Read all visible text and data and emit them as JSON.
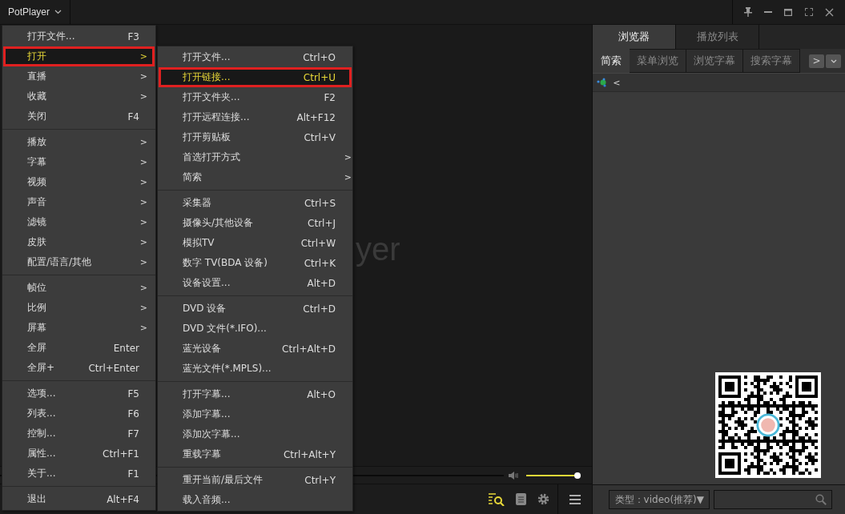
{
  "title_bar": {
    "app_name": "PotPlayer"
  },
  "video": {
    "logo_text": "yer"
  },
  "main_menu": [
    [
      {
        "label": "打开文件...",
        "shortcut": "F3",
        "selected": false
      },
      {
        "label": "打开",
        "arrow": ">",
        "selected": true
      },
      {
        "label": "直播",
        "arrow": ">",
        "selected": false
      },
      {
        "label": "收藏",
        "arrow": ">",
        "selected": false
      },
      {
        "label": "关闭",
        "shortcut": "F4",
        "selected": false
      }
    ],
    [
      {
        "label": "播放",
        "arrow": ">",
        "selected": false
      },
      {
        "label": "字幕",
        "arrow": ">",
        "selected": false
      },
      {
        "label": "视频",
        "arrow": ">",
        "selected": false
      },
      {
        "label": "声音",
        "arrow": ">",
        "selected": false
      },
      {
        "label": "滤镜",
        "arrow": ">",
        "selected": false
      },
      {
        "label": "皮肤",
        "arrow": ">",
        "selected": false
      },
      {
        "label": "配置/语言/其他",
        "arrow": ">",
        "selected": false
      }
    ],
    [
      {
        "label": "帧位",
        "arrow": ">",
        "selected": false
      },
      {
        "label": "比例",
        "arrow": ">",
        "selected": false
      },
      {
        "label": "屏幕",
        "arrow": ">",
        "selected": false
      },
      {
        "label": "全屏",
        "shortcut": "Enter",
        "selected": false
      },
      {
        "label": "全屏+",
        "shortcut": "Ctrl+Enter",
        "selected": false
      }
    ],
    [
      {
        "label": "选项...",
        "shortcut": "F5",
        "selected": false
      },
      {
        "label": "列表...",
        "shortcut": "F6",
        "selected": false
      },
      {
        "label": "控制...",
        "shortcut": "F7",
        "selected": false
      },
      {
        "label": "属性...",
        "shortcut": "Ctrl+F1",
        "selected": false
      },
      {
        "label": "关于...",
        "shortcut": "F1",
        "selected": false
      }
    ],
    [
      {
        "label": "退出",
        "shortcut": "Alt+F4",
        "selected": false
      }
    ]
  ],
  "sub_menu": [
    [
      {
        "label": "打开文件...",
        "shortcut": "Ctrl+O",
        "selected": false
      },
      {
        "label": "打开链接...",
        "shortcut": "Ctrl+U",
        "selected": true
      },
      {
        "label": "打开文件夹...",
        "shortcut": "F2",
        "selected": false
      },
      {
        "label": "打开远程连接...",
        "shortcut": "Alt+F12",
        "selected": false
      },
      {
        "label": "打开剪贴板",
        "shortcut": "Ctrl+V",
        "selected": false
      },
      {
        "label": "首选打开方式",
        "arrow": ">",
        "selected": false
      },
      {
        "label": "简索",
        "arrow": ">",
        "selected": false
      }
    ],
    [
      {
        "label": "采集器",
        "shortcut": "Ctrl+S",
        "selected": false
      },
      {
        "label": "摄像头/其他设备",
        "shortcut": "Ctrl+J",
        "selected": false
      },
      {
        "label": "模拟TV",
        "shortcut": "Ctrl+W",
        "selected": false
      },
      {
        "label": "数字 TV(BDA 设备)",
        "shortcut": "Ctrl+K",
        "selected": false
      },
      {
        "label": "设备设置...",
        "shortcut": "Alt+D",
        "selected": false
      }
    ],
    [
      {
        "label": "DVD 设备",
        "shortcut": "Ctrl+D",
        "selected": false
      },
      {
        "label": "DVD 文件(*.IFO)...",
        "selected": false
      },
      {
        "label": "蓝光设备",
        "shortcut": "Ctrl+Alt+D",
        "selected": false
      },
      {
        "label": "蓝光文件(*.MPLS)...",
        "selected": false
      }
    ],
    [
      {
        "label": "打开字幕...",
        "shortcut": "Alt+O",
        "selected": false
      },
      {
        "label": "添加字幕...",
        "selected": false
      },
      {
        "label": "添加次字幕...",
        "selected": false
      },
      {
        "label": "重载字幕",
        "shortcut": "Ctrl+Alt+Y",
        "selected": false
      }
    ],
    [
      {
        "label": "重开当前/最后文件",
        "shortcut": "Ctrl+Y",
        "selected": false
      },
      {
        "label": "载入音频...",
        "selected": false
      }
    ]
  ],
  "volume": {
    "level": 1
  },
  "panel": {
    "tabs": [
      {
        "label": "浏览器",
        "selected": true
      },
      {
        "label": "播放列表",
        "selected": false
      }
    ],
    "subtabs": [
      {
        "label": "简索",
        "selected": true
      },
      {
        "label": "菜单浏览",
        "selected": false
      },
      {
        "label": "浏览字幕",
        "selected": false
      },
      {
        "label": "搜索字幕",
        "selected": false
      }
    ],
    "next_arrow": ">",
    "back_button": "<",
    "type_dropdown": "类型：video(推荐)▼"
  }
}
